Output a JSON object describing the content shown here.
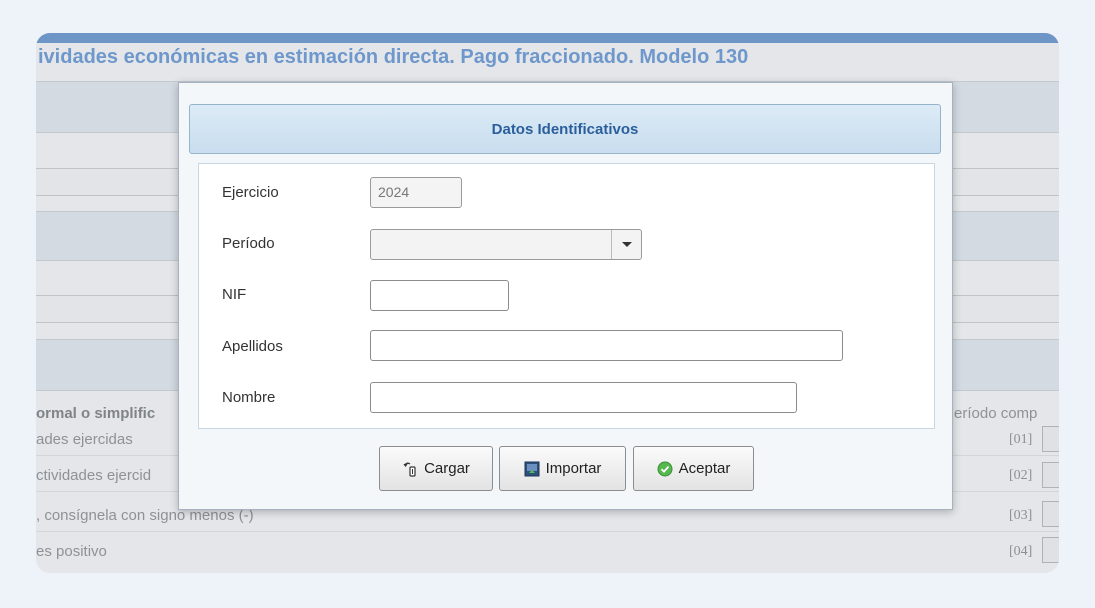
{
  "background": {
    "title": "ividades económicas en estimación directa. Pago fraccionado. Modelo 130",
    "section_label": "ormal o simplific",
    "right_header": "eríodo comp",
    "rows": [
      {
        "text": "ades ejercidas",
        "code": "[01]"
      },
      {
        "text": "ctividades ejercid",
        "code": "[02]"
      },
      {
        "text": ", consígnela con signo menos (-)",
        "code": "[03]"
      },
      {
        "text": "es positivo",
        "code": "[04]"
      }
    ]
  },
  "dialog": {
    "title": "Datos Identificativos",
    "fields": {
      "ejercicio": {
        "label": "Ejercicio",
        "value": "2024"
      },
      "periodo": {
        "label": "Período",
        "value": ""
      },
      "nif": {
        "label": "NIF",
        "value": ""
      },
      "apellidos": {
        "label": "Apellidos",
        "value": ""
      },
      "nombre": {
        "label": "Nombre",
        "value": ""
      }
    },
    "buttons": {
      "cargar": "Cargar",
      "importar": "Importar",
      "aceptar": "Aceptar"
    }
  },
  "colors": {
    "accent": "#2a5f9c",
    "bg_title": "#6e98cc",
    "topbar": "#6d95c6"
  }
}
